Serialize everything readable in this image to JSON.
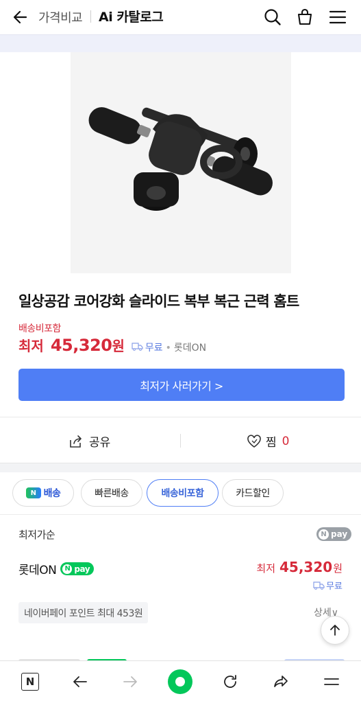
{
  "header": {
    "crumb": "가격비교",
    "title": "Ai 카탈로그"
  },
  "product": {
    "title": "일상공감 코어강화 슬라이드 복부 복근 근력 홈트",
    "shipping_included": "배송비포함",
    "price_label": "최저",
    "price": "45,320",
    "price_unit": "원",
    "free_shipping": "무료",
    "mall": "롯데ON",
    "cta": "최저가 사러가기 >"
  },
  "actions": {
    "share": "공유",
    "favorite": "찜",
    "favorite_count": "0"
  },
  "filters": [
    {
      "label": "배송",
      "badge": "N"
    },
    {
      "label": "빠른배송"
    },
    {
      "label": "배송비포함"
    },
    {
      "label": "카드할인"
    }
  ],
  "offers": {
    "section_label": "최저가순",
    "npay": "pay",
    "npay_n": "N",
    "first": {
      "mall": "롯데ON",
      "price_label": "최저",
      "price": "45,320",
      "price_unit": "원",
      "shipping": "무료",
      "points": "네이버페이 포인트 최대 453원",
      "detail": "상세∨"
    }
  },
  "bottom_bar": {
    "n_label": "N"
  },
  "colors": {
    "accent_blue": "#4f7ef5",
    "price_red": "#d62a3a",
    "naver_green": "#03c75a"
  },
  "icons": [
    "back-arrow-icon",
    "search-icon",
    "shopping-bag-icon",
    "menu-icon",
    "expand-icon",
    "share-icon",
    "heart-icon",
    "truck-icon",
    "arrow-up-icon",
    "forward-arrow-icon",
    "refresh-icon",
    "share-arrow-icon"
  ]
}
